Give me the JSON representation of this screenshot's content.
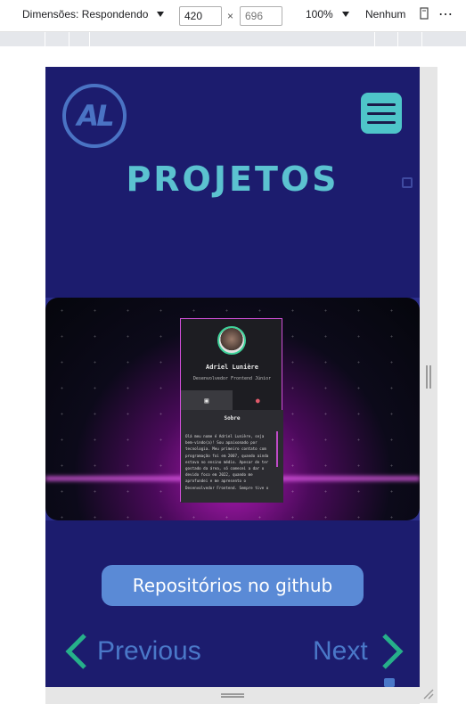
{
  "devtools": {
    "dimensions_label": "Dimensões: Respondendo",
    "width_value": "420",
    "height_placeholder": "696",
    "times": "×",
    "zoom": "100%",
    "throttle": "Nenhum",
    "more_label": "⋯"
  },
  "page": {
    "logo_text": "AL",
    "title": "PROJETOS",
    "repo_button": "Repositórios no github",
    "prev_label": "Previous",
    "next_label": "Next",
    "accent": "#5bc2d0",
    "background": "#1c1c6e"
  },
  "project_preview": {
    "name": "Adriel Lunière",
    "role": "Desenvolvedor Frontend Júnior",
    "section": "Sobre",
    "about_text": "Olá meu nome é Adriel Lunière, seja bem-vindo(a)! Sou apaixonado por tecnologia. Meu primeiro contato com programação foi em 2007, quando ainda estava no ensino médio. Apesar de ter gostado da área, só comecei a dar o devido foco em 2022, quando me aprofundei e me apresento o Desenvolvedor Frontend. Sempre tive o"
  }
}
